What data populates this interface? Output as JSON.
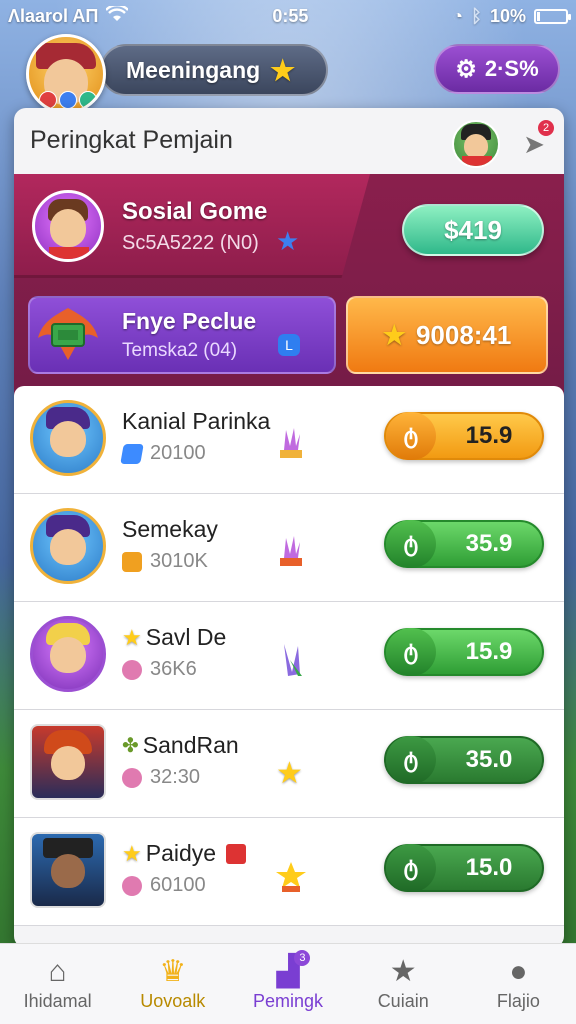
{
  "status": {
    "carrier": "Λlaarol AΠ",
    "time": "0:55",
    "battery": "10%",
    "battery_level": 0.1
  },
  "header": {
    "player_name": "Meeningang",
    "settings_value": "2·S%"
  },
  "leaderboard": {
    "title": "Peringkat Pemjain",
    "share_badge": "2",
    "featured_top": {
      "name": "Sosial Gome",
      "sub": "Sc5A5222 (N0)",
      "value": "$419"
    },
    "featured_second": {
      "name": "Fnye Peclue",
      "sub": "Temska2 (04)",
      "tag": "L",
      "value": "9008:41"
    },
    "rows": [
      {
        "name": "Kanial Parinka",
        "stat": "20100",
        "score": "15.9",
        "style": "orange"
      },
      {
        "name": "Semekay",
        "stat": "3010K",
        "score": "35.9",
        "style": "green"
      },
      {
        "name": "Savl De",
        "stat": "36K6",
        "score": "15.9",
        "style": "green"
      },
      {
        "name": "SandRan",
        "stat": "32:30",
        "score": "35.0",
        "style": "dark"
      },
      {
        "name": "Paidye",
        "stat": "60100",
        "score": "15.0",
        "style": "dark"
      }
    ]
  },
  "nav": {
    "items": [
      {
        "label": "Ihidamal",
        "icon": "home-icon"
      },
      {
        "label": "Uovoalk",
        "icon": "crown-icon"
      },
      {
        "label": "Pemingk",
        "icon": "leaderboard-icon",
        "badge": "3"
      },
      {
        "label": "Cuiain",
        "icon": "star-icon"
      },
      {
        "label": "Flajio",
        "icon": "profile-icon"
      }
    ]
  },
  "colors": {
    "maroon": "#7a1d48",
    "purple": "#7a3ed2",
    "orange": "#f29a12",
    "green": "#2f9e35",
    "teal": "#2fb88a"
  }
}
